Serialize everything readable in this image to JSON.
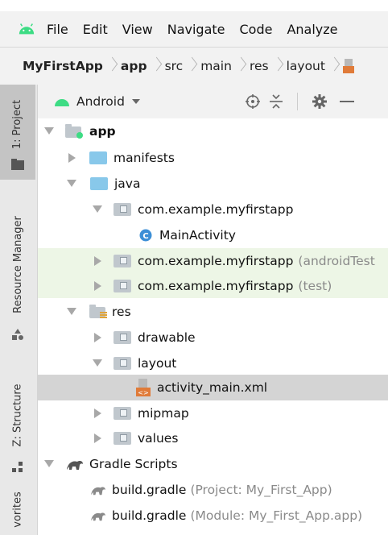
{
  "menubar": {
    "items": [
      {
        "label": "File"
      },
      {
        "label": "Edit"
      },
      {
        "label": "View"
      },
      {
        "label": "Navigate"
      },
      {
        "label": "Code"
      },
      {
        "label": "Analyze"
      }
    ]
  },
  "breadcrumb": {
    "items": [
      "MyFirstApp",
      "app",
      "src",
      "main",
      "res",
      "layout"
    ]
  },
  "side_tabs": {
    "project": "1: Project",
    "resource_manager": "Resource Manager",
    "structure": "Z: Structure",
    "favorites": "vorites"
  },
  "panel": {
    "view_selector": "Android"
  },
  "tree": {
    "app": "app",
    "manifests": "manifests",
    "java": "java",
    "pkg_main": "com.example.myfirstapp",
    "main_activity": "MainActivity",
    "pkg_android_test": "com.example.myfirstapp",
    "android_test_suffix": "(androidTest",
    "pkg_test": "com.example.myfirstapp",
    "test_suffix": "(test)",
    "res": "res",
    "drawable": "drawable",
    "layout": "layout",
    "activity_main": "activity_main.xml",
    "mipmap": "mipmap",
    "values": "values",
    "gradle_scripts": "Gradle Scripts",
    "build_gradle_1": "build.gradle",
    "build_gradle_1_suffix": "(Project: My_First_App)",
    "build_gradle_2": "build.gradle",
    "build_gradle_2_suffix": "(Module: My_First_App.app)"
  },
  "colors": {
    "android_green": "#3ddc84",
    "folder_blue": "#88c8ea",
    "folder_gray": "#c0c7cd",
    "xml_orange": "#e07b39",
    "class_icon_blue": "#3d8fd6",
    "test_row_green": "#edf6e6",
    "selected_row": "#d4d4d4"
  }
}
